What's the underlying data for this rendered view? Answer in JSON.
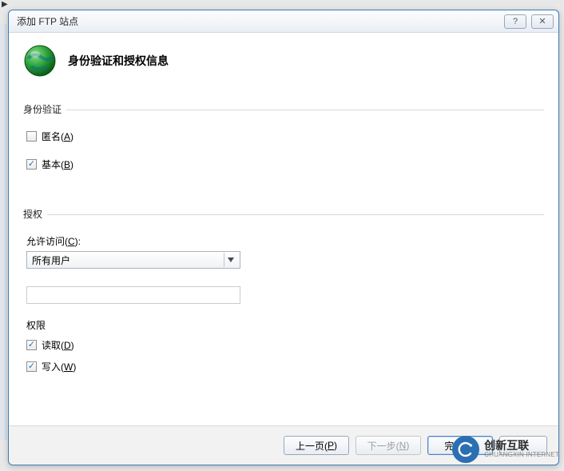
{
  "titlebar": {
    "title": "添加 FTP 站点",
    "help_icon": "help-icon",
    "close_icon": "close-icon"
  },
  "header": {
    "title": "身份验证和授权信息"
  },
  "auth_group": {
    "legend": "身份验证",
    "anonymous_label": "匿名(A)",
    "anonymous_checked": false,
    "basic_label": "基本(B)",
    "basic_checked": true
  },
  "authz_group": {
    "legend": "授权",
    "allow_label": "允许访问(C):",
    "allow_value": "所有用户",
    "textbox_value": "",
    "perm_legend": "权限",
    "read_label": "读取(D)",
    "read_checked": true,
    "write_label": "写入(W)",
    "write_checked": true
  },
  "footer": {
    "prev": "上一页(P)",
    "next": "下一步(N)",
    "finish": "完成(F)",
    "cancel": ""
  },
  "watermark": {
    "cn": "创新互联",
    "en": "CHUANGXIN INTERNET",
    "logo_letter": "C"
  }
}
